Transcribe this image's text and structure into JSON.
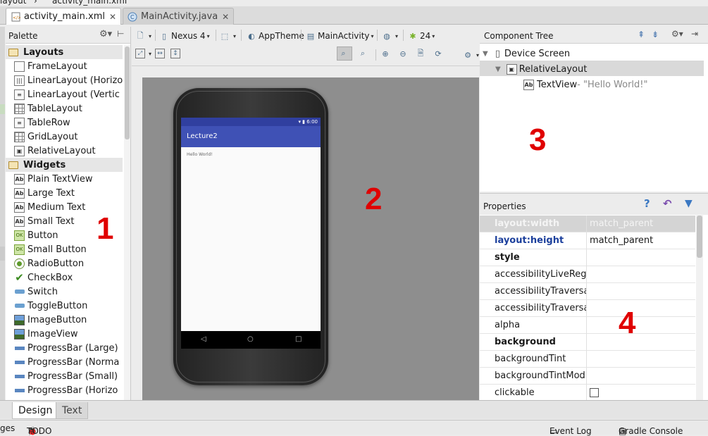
{
  "breadcrumbs": [
    "layout",
    "activity_main.xml"
  ],
  "editor_tabs": [
    {
      "label": "activity_main.xml",
      "icon": "xml-file-icon",
      "active": true
    },
    {
      "label": "MainActivity.java",
      "icon": "java-class-icon",
      "active": false
    }
  ],
  "palette": {
    "title": "Palette",
    "groups": [
      {
        "label": "Layouts",
        "items": [
          "FrameLayout",
          "LinearLayout (Horizo",
          "LinearLayout (Vertic",
          "TableLayout",
          "TableRow",
          "GridLayout",
          "RelativeLayout"
        ]
      },
      {
        "label": "Widgets",
        "items": [
          "Plain TextView",
          "Large Text",
          "Medium Text",
          "Small Text",
          "Button",
          "Small Button",
          "RadioButton",
          "CheckBox",
          "Switch",
          "ToggleButton",
          "ImageButton",
          "ImageView",
          "ProgressBar (Large)",
          "ProgressBar (Norma",
          "ProgressBar (Small)",
          "ProgressBar (Horizo"
        ]
      }
    ]
  },
  "toolbar": {
    "device": "Nexus 4",
    "theme": "AppTheme",
    "activity": "MainActivity",
    "api_level": "24"
  },
  "preview": {
    "status_time": "6:00",
    "app_title": "Lecture2",
    "content_text": "Hello World!"
  },
  "component_tree": {
    "title": "Component Tree",
    "nodes": [
      {
        "label": "Device Screen"
      },
      {
        "label": "RelativeLayout"
      },
      {
        "label": "TextView",
        "detail": " - \"Hello World!\""
      }
    ]
  },
  "properties": {
    "title": "Properties",
    "rows": [
      {
        "name": "layout:width",
        "value": "match_parent"
      },
      {
        "name": "layout:height",
        "value": "match_parent"
      },
      {
        "name": "style",
        "value": ""
      },
      {
        "name": "accessibilityLiveRegi",
        "value": ""
      },
      {
        "name": "accessibilityTraversa",
        "value": ""
      },
      {
        "name": "accessibilityTraversa",
        "value": ""
      },
      {
        "name": "alpha",
        "value": ""
      },
      {
        "name": "background",
        "value": ""
      },
      {
        "name": "backgroundTint",
        "value": ""
      },
      {
        "name": "backgroundTintMod",
        "value": ""
      },
      {
        "name": "clickable",
        "value": ""
      }
    ]
  },
  "annotations": [
    "1",
    "2",
    "3",
    "4"
  ],
  "bottom_tabs": [
    "Design",
    "Text"
  ],
  "statusbar": {
    "left_cut": "ges",
    "todo": "TODO",
    "event_log": "Event Log",
    "gradle_console": "Gradle Console"
  },
  "colors": {
    "app_primary": "#3f51b5",
    "app_primary_dark": "#303f9f",
    "annotation_red": "#e00000",
    "selected_row": "#d4d4d4"
  }
}
